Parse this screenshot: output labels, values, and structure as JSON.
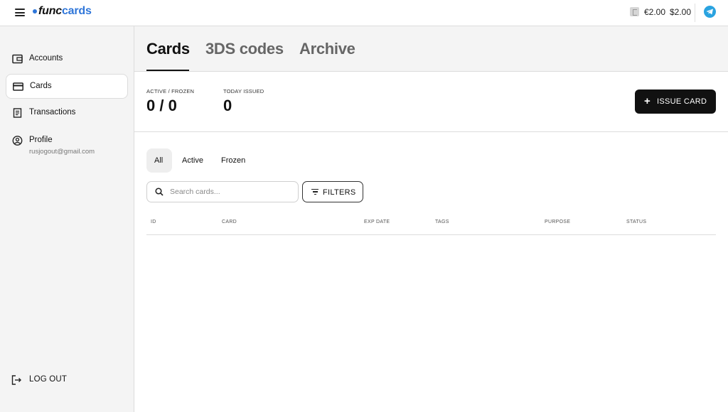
{
  "app": {
    "logo_func": "func",
    "logo_cards": "cards"
  },
  "topbar": {
    "balance_eur": "€2.00",
    "balance_usd": "$2.00",
    "icons": [
      "menu-icon",
      "wallet-icon",
      "telegram-icon"
    ]
  },
  "sidebar": {
    "items": [
      {
        "label": "Accounts",
        "icon": "wallet-icon"
      },
      {
        "label": "Cards",
        "icon": "credit-card-icon",
        "active": true
      },
      {
        "label": "Transactions",
        "icon": "receipt-icon"
      },
      {
        "label": "Profile",
        "icon": "user-circle-icon",
        "sub": "rusjogout@gmail.com"
      }
    ],
    "logout_label": "LOG OUT"
  },
  "tabs": [
    {
      "label": "Cards",
      "active": true
    },
    {
      "label": "3DS codes"
    },
    {
      "label": "Archive"
    }
  ],
  "stats": {
    "active_frozen_label": "ACTIVE / FROZEN",
    "active_frozen_value": "0 / 0",
    "today_issued_label": "TODAY ISSUED",
    "today_issued_value": "0"
  },
  "issue_button_label": "ISSUE CARD",
  "filter_tabs": [
    {
      "label": "All",
      "active": true
    },
    {
      "label": "Active"
    },
    {
      "label": "Frozen"
    }
  ],
  "search": {
    "placeholder": "Search cards...",
    "value": ""
  },
  "filters_button_label": "FILTERS",
  "table": {
    "columns": [
      "ID",
      "CARD",
      "EXP DATE",
      "TAGS",
      "PURPOSE",
      "STATUS"
    ],
    "rows": []
  },
  "colors": {
    "accent": "#2f76d9",
    "primary_button": "#111111",
    "sidebar_bg": "#f4f4f4",
    "telegram": "#2aa3e0"
  }
}
